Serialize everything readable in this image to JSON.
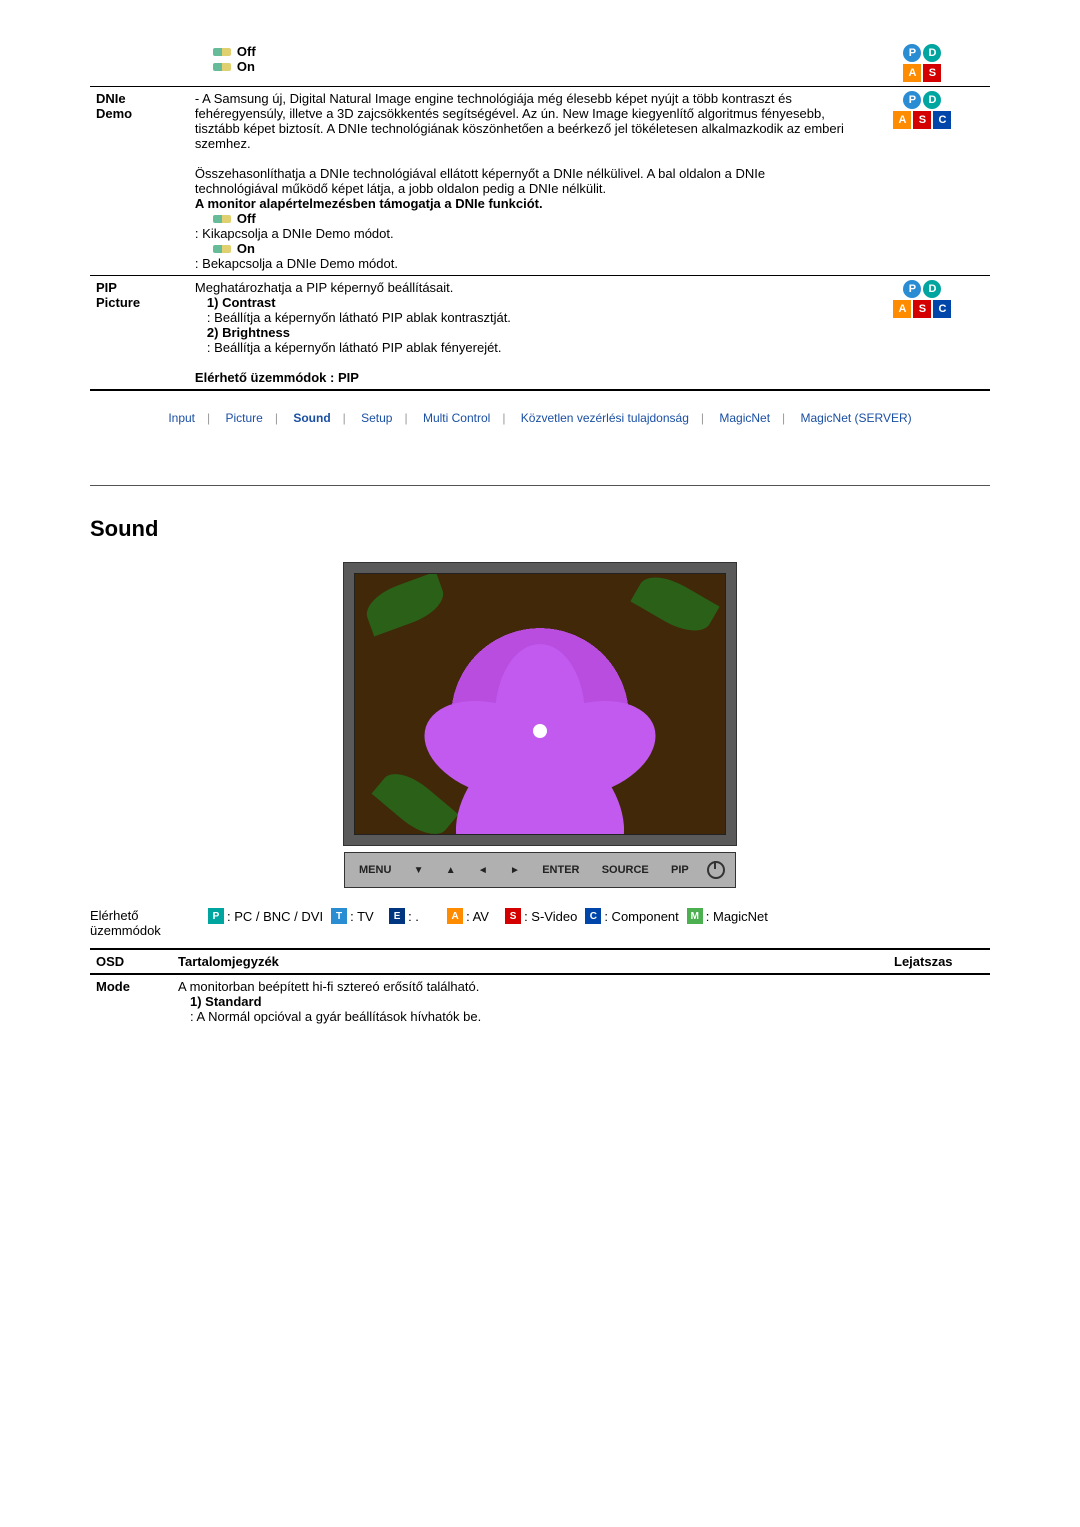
{
  "table1": {
    "off": "Off",
    "on": "On",
    "row_dnie": {
      "label1": "DNIe",
      "label2": "Demo",
      "para1": "- A Samsung új, Digital Natural Image engine technológiája még élesebb képet nyújt a több kontraszt és fehéregyensúly, illetve a 3D zajcsökkentés segítségével. Az ún. New Image kiegyenlítő algoritmus fényesebb, tisztább képet biztosít. A DNIe technológiának köszönhetően a beérkező jel tökéletesen alkalmazkodik az emberi szemhez.",
      "para2": "Összehasonlíthatja a DNIe technológiával ellátott képernyőt a DNIe nélkülivel. A bal oldalon a DNIe technológiával működő képet látja, a jobb oldalon pedig a DNIe nélkülit.",
      "bold1": "A monitor alapértelmezésben támogatja a DNIe funkciót.",
      "off": "Off",
      "off_desc": ": Kikapcsolja a DNIe Demo módot.",
      "on": "On",
      "on_desc": ": Bekapcsolja a DNIe Demo módot."
    },
    "row_pip": {
      "label1": "PIP",
      "label2": "Picture",
      "intro": "Meghatározhatja a PIP képernyő beállításait.",
      "c1": "1) Contrast",
      "c1d": ": Beállítja a képernyőn látható PIP ablak kontrasztját.",
      "c2": "2) Brightness",
      "c2d": ": Beállítja a képernyőn látható PIP ablak fényerejét.",
      "avail": "Elérhető üzemmódok : PIP"
    }
  },
  "tabs": {
    "input": "Input",
    "picture": "Picture",
    "sound": "Sound",
    "setup": "Setup",
    "multi": "Multi Control",
    "direct": "Közvetlen vezérlési tulajdonság",
    "magicnet": "MagicNet",
    "server": "MagicNet (SERVER)"
  },
  "section_title": "Sound",
  "ctrl": {
    "menu": "MENU",
    "enter": "ENTER",
    "source": "SOURCE",
    "pip": "PIP"
  },
  "modes": {
    "label1": "Elérhető",
    "label2": "üzemmódok",
    "p_txt": ": PC / BNC / DVI",
    "t_txt": ": TV",
    "e_txt": ": .",
    "a_txt": ": AV",
    "s_txt": ": S-Video",
    "c_txt": ": Component",
    "m_txt": ": MagicNet"
  },
  "osd": {
    "h_osd": "OSD",
    "h_toc": "Tartalomjegyzék",
    "h_play": "Lejatszas",
    "r_mode": "Mode",
    "mode_intro": "A monitorban beépített hi-fi sztereó erősítő található.",
    "mode_s1": "1) Standard",
    "mode_s1d": ": A Normál opcióval a gyár beállítások hívhatók be."
  }
}
